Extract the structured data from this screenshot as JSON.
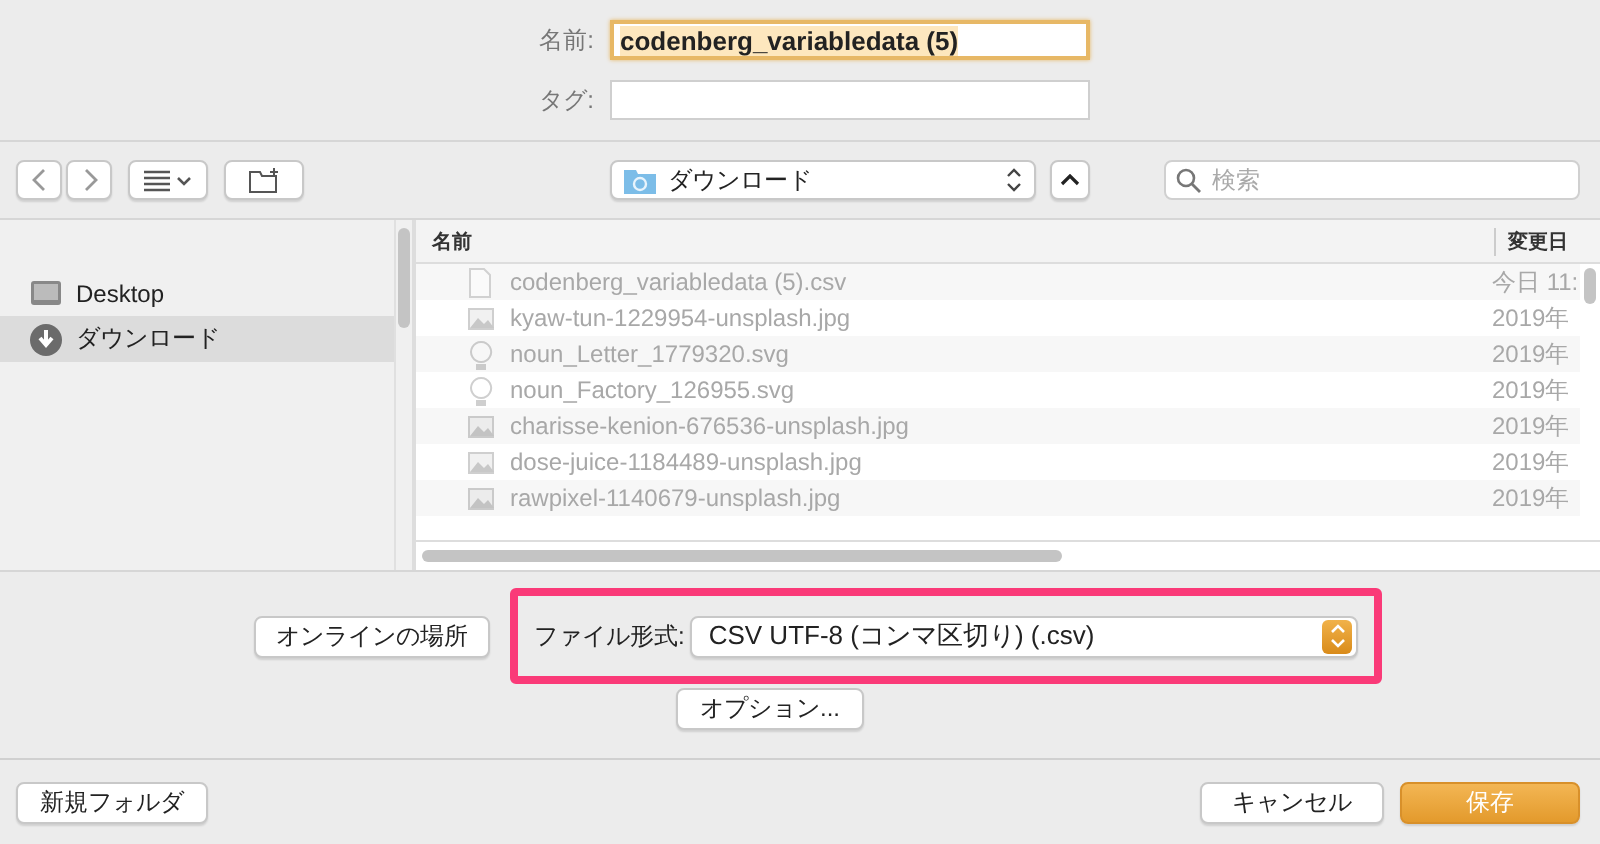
{
  "name_field": {
    "label": "名前:",
    "value": "codenberg_variabledata (5)"
  },
  "tags_field": {
    "label": "タグ:"
  },
  "toolbar": {
    "location": "ダウンロード",
    "search": {
      "placeholder": "検索"
    }
  },
  "sidebar": {
    "items": [
      {
        "label": "Desktop",
        "kind": "desktop",
        "selected": false
      },
      {
        "label": "ダウンロード",
        "kind": "download",
        "selected": true
      }
    ]
  },
  "file_list": {
    "columns": [
      "名前",
      "変更日"
    ],
    "rows": [
      {
        "name": "codenberg_variabledata (5).csv",
        "date": "今日 11:",
        "kind": "document",
        "disabled": true
      },
      {
        "name": "kyaw-tun-1229954-unsplash.jpg",
        "date": "2019年",
        "kind": "image",
        "disabled": true
      },
      {
        "name": "noun_Letter_1779320.svg",
        "date": "2019年",
        "kind": "vector",
        "disabled": true
      },
      {
        "name": "noun_Factory_126955.svg",
        "date": "2019年",
        "kind": "vector",
        "disabled": true
      },
      {
        "name": "charisse-kenion-676536-unsplash.jpg",
        "date": "2019年",
        "kind": "image",
        "disabled": true
      },
      {
        "name": "dose-juice-1184489-unsplash.jpg",
        "date": "2019年",
        "kind": "image",
        "disabled": true
      },
      {
        "name": "rawpixel-1140679-unsplash.jpg",
        "date": "2019年",
        "kind": "image",
        "disabled": true
      }
    ]
  },
  "online_button": "オンラインの場所",
  "file_format": {
    "label": "ファイル形式:",
    "value": "CSV UTF-8 (コンマ区切り) (.csv)",
    "highlighted": true
  },
  "options_button": "オプション...",
  "footer": {
    "new_folder": "新規フォルダ",
    "cancel": "キャンセル",
    "save": "保存"
  }
}
